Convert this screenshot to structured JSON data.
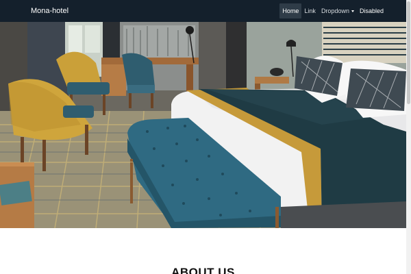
{
  "navbar": {
    "brand": "Mona-hotel",
    "items": [
      {
        "label": "Home",
        "active": true
      },
      {
        "label": "Link"
      },
      {
        "label": "Dropdown"
      },
      {
        "label": "Disabled"
      }
    ]
  },
  "carousel": {
    "image": "hotel-room-photo",
    "indicators": 3,
    "active_index": 1
  },
  "about": {
    "title": "ABOUT US"
  },
  "colors": {
    "navbar_bg": "#14202c",
    "nav_active_bg": "#2f3c48"
  }
}
